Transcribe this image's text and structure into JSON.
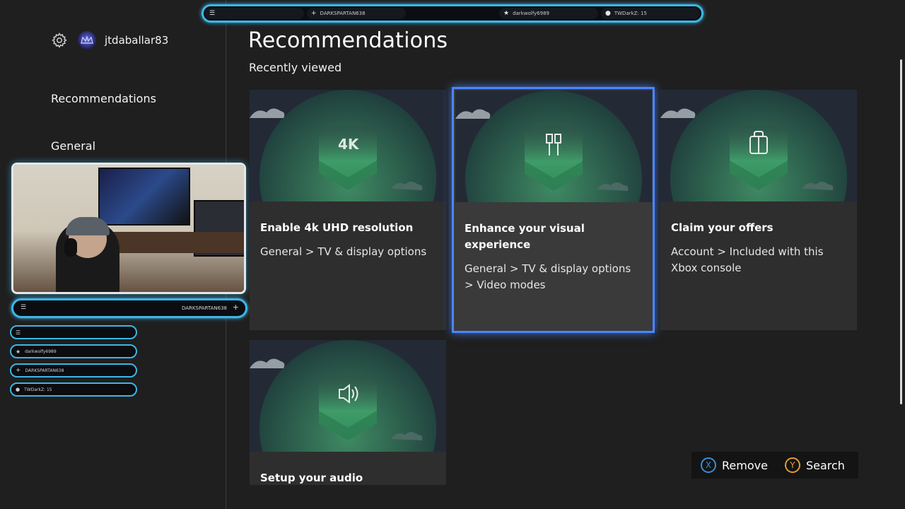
{
  "user": {
    "name": "jtdaballar83"
  },
  "nav": {
    "items": [
      {
        "label": "Recommendations"
      },
      {
        "label": "General"
      }
    ]
  },
  "main": {
    "title": "Recommendations",
    "section": "Recently viewed",
    "cards": [
      {
        "icon": "4k-icon",
        "icon_text": "4K",
        "title": "Enable 4k UHD resolution",
        "path": "General > TV & display options"
      },
      {
        "icon": "hdmi-cable-icon",
        "title": "Enhance your visual experience",
        "path": "General > TV & display options > Video modes",
        "focused": true
      },
      {
        "icon": "gift-bag-icon",
        "title": "Claim your offers",
        "path": "Account > Included with this Xbox console"
      },
      {
        "icon": "speaker-icon",
        "title": "Setup your audio",
        "path": ""
      }
    ]
  },
  "hints": {
    "remove_button": "X",
    "remove_label": "Remove",
    "search_button": "Y",
    "search_label": "Search"
  },
  "overlay": {
    "top": {
      "slot2": "DARKSPARTAN638",
      "slot3": "darkwolfy6989",
      "slot4": "TWDarkZ: 15"
    },
    "cam_bar": {
      "label": "DARKSPARTAN638"
    },
    "side": [
      {
        "label": ""
      },
      {
        "label": "darkwolfy6989"
      },
      {
        "label": "DARKSPARTAN638"
      },
      {
        "label": "TWDarkZ: 15"
      }
    ]
  },
  "colors": {
    "accent_focus": "#4a86ff",
    "overlay_glow": "#3cb6e6",
    "button_x": "#3a8ed6",
    "button_y": "#e39a3b",
    "shield_green": "#3fa86a"
  }
}
